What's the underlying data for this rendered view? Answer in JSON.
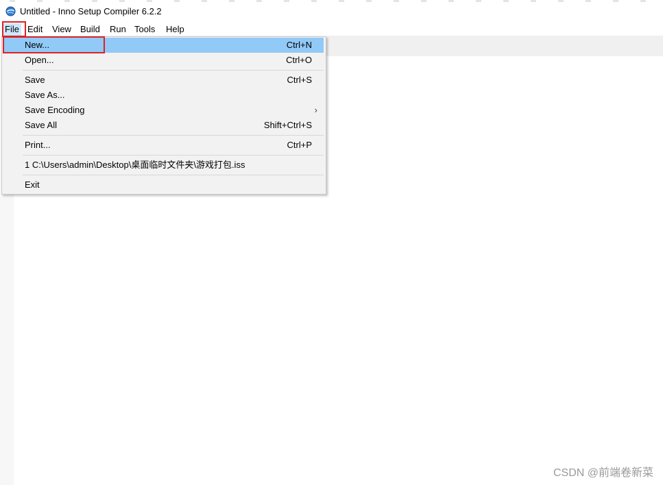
{
  "window": {
    "title": "Untitled - Inno Setup Compiler 6.2.2",
    "icon": "inno-setup-globe-icon"
  },
  "menubar": {
    "items": [
      "File",
      "Edit",
      "View",
      "Build",
      "Run",
      "Tools",
      "Help"
    ],
    "active": "File"
  },
  "file_menu": {
    "items": [
      {
        "label": "New...",
        "shortcut": "Ctrl+N",
        "highlighted": true
      },
      {
        "label": "Open...",
        "shortcut": "Ctrl+O"
      },
      {
        "label": "Save",
        "shortcut": "Ctrl+S"
      },
      {
        "label": "Save As...",
        "shortcut": ""
      },
      {
        "label": "Save Encoding",
        "shortcut": "",
        "submenu": true
      },
      {
        "label": "Save All",
        "shortcut": "Shift+Ctrl+S"
      },
      {
        "label": "Print...",
        "shortcut": "Ctrl+P"
      },
      {
        "label": "1 C:\\Users\\admin\\Desktop\\桌面临时文件夹\\游戏打包.iss",
        "shortcut": ""
      },
      {
        "label": "Exit",
        "shortcut": ""
      }
    ],
    "submenu_arrow": "›"
  },
  "annotations": {
    "highlight_color": "#e02020"
  },
  "watermark": "CSDN @前端卷新菜"
}
